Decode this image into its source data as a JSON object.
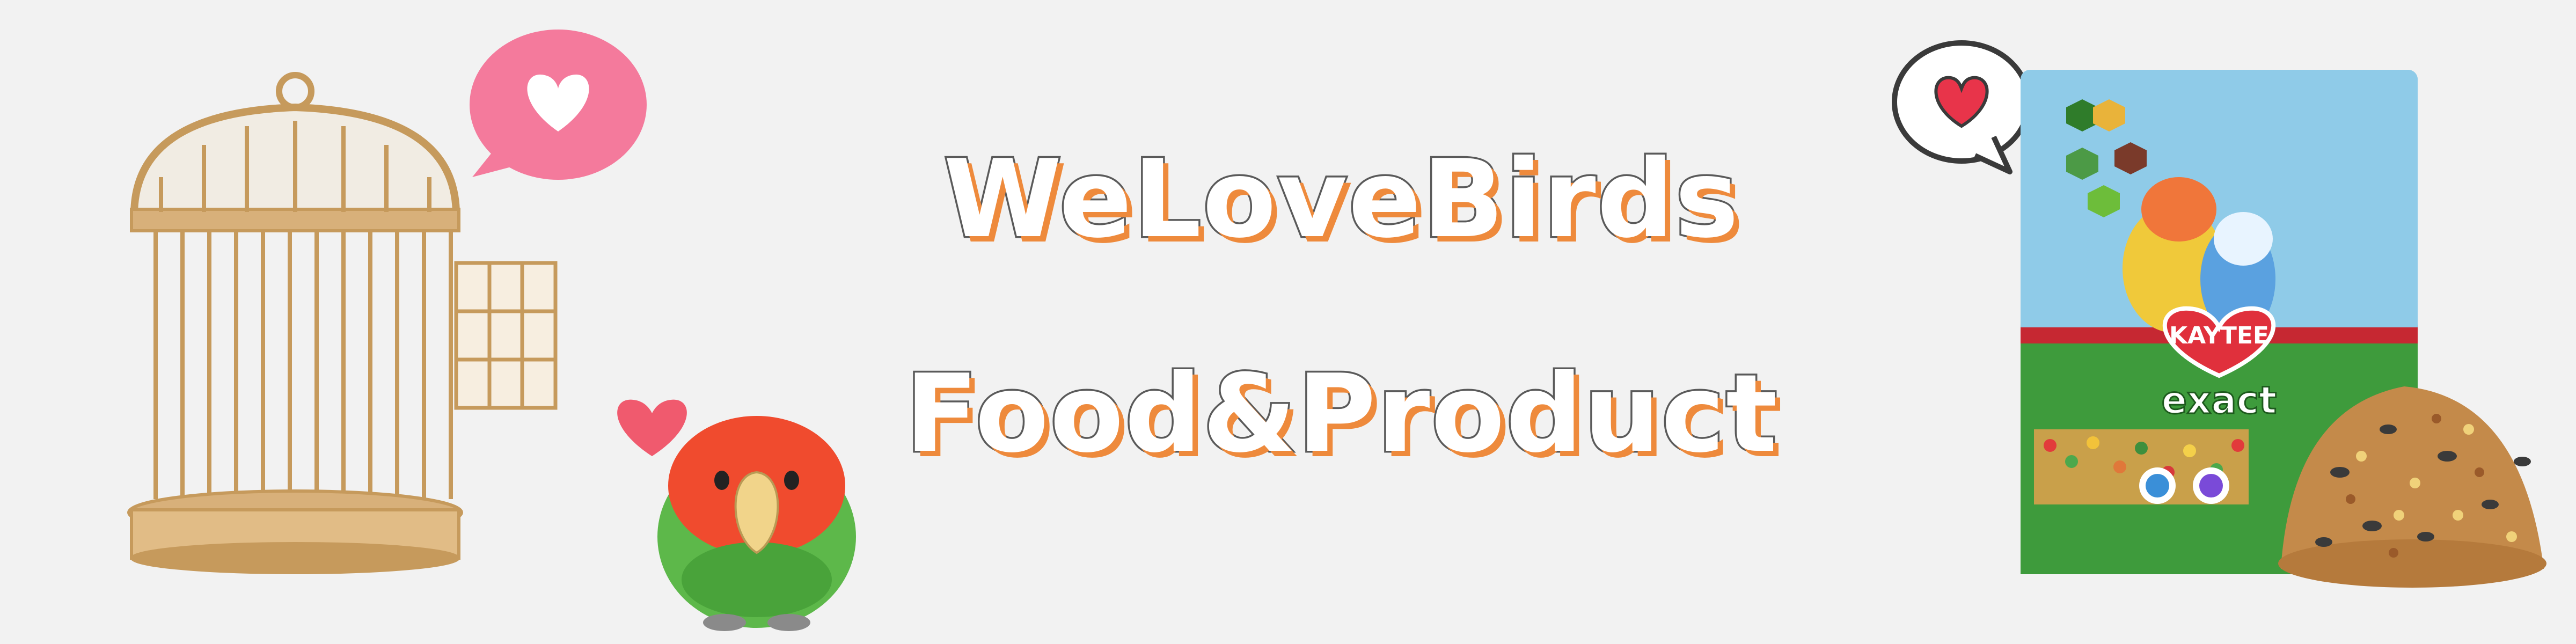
{
  "banner": {
    "title_line1": "WeLoveBirds",
    "title_line2": "Food&Product",
    "background_color": "#f2f2f2",
    "outline_color": "#5a5a5a",
    "shadow_color": "#ee8a3c"
  },
  "product_bag": {
    "brand": "KAYTEE",
    "product": "exact"
  },
  "icons": [
    "birdcage-icon",
    "heart-speech-bubble-icon",
    "heart-icon",
    "lovebird-plush-icon",
    "heart-outline-bubble-icon",
    "bird-food-bag-icon",
    "seed-pile-icon"
  ]
}
